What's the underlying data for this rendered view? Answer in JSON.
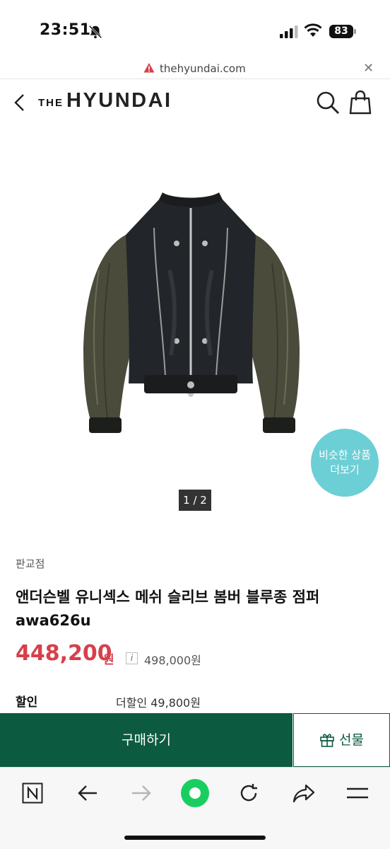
{
  "status_bar": {
    "time": "23:51",
    "battery": "83"
  },
  "url_bar": {
    "url": "thehyundai.com"
  },
  "header": {
    "logo_the": "THE",
    "logo_main": "HYUNDAI"
  },
  "gallery": {
    "page_indicator": "1 / 2",
    "similar_line1": "비슷한 상품",
    "similar_line2": "더보기"
  },
  "product": {
    "seller": "판교점",
    "title": "앤더슨벨 유니섹스 메쉬 슬리브 봄버 블루종 점퍼 awa626u",
    "sale_price": "448,200",
    "currency": "원",
    "info_symbol": "i",
    "original_price": "498,000원",
    "discount_label": "할인",
    "discount_value": "더할인 49,800원"
  },
  "cta": {
    "buy_label": "구매하기",
    "gift_label": "선물"
  },
  "colors": {
    "brand_green": "#0c5a3f",
    "price_red": "#d6404b",
    "badge_teal": "#6ccfd6"
  },
  "icons": [
    "bell-slash-icon",
    "signal-icon",
    "wifi-icon",
    "warning-icon",
    "close-icon",
    "back-icon",
    "search-icon",
    "shopping-bag-icon",
    "gift-icon",
    "naver-icon",
    "back-arrow-icon",
    "forward-arrow-icon",
    "green-dot-icon",
    "reload-icon",
    "share-icon",
    "menu-icon"
  ]
}
